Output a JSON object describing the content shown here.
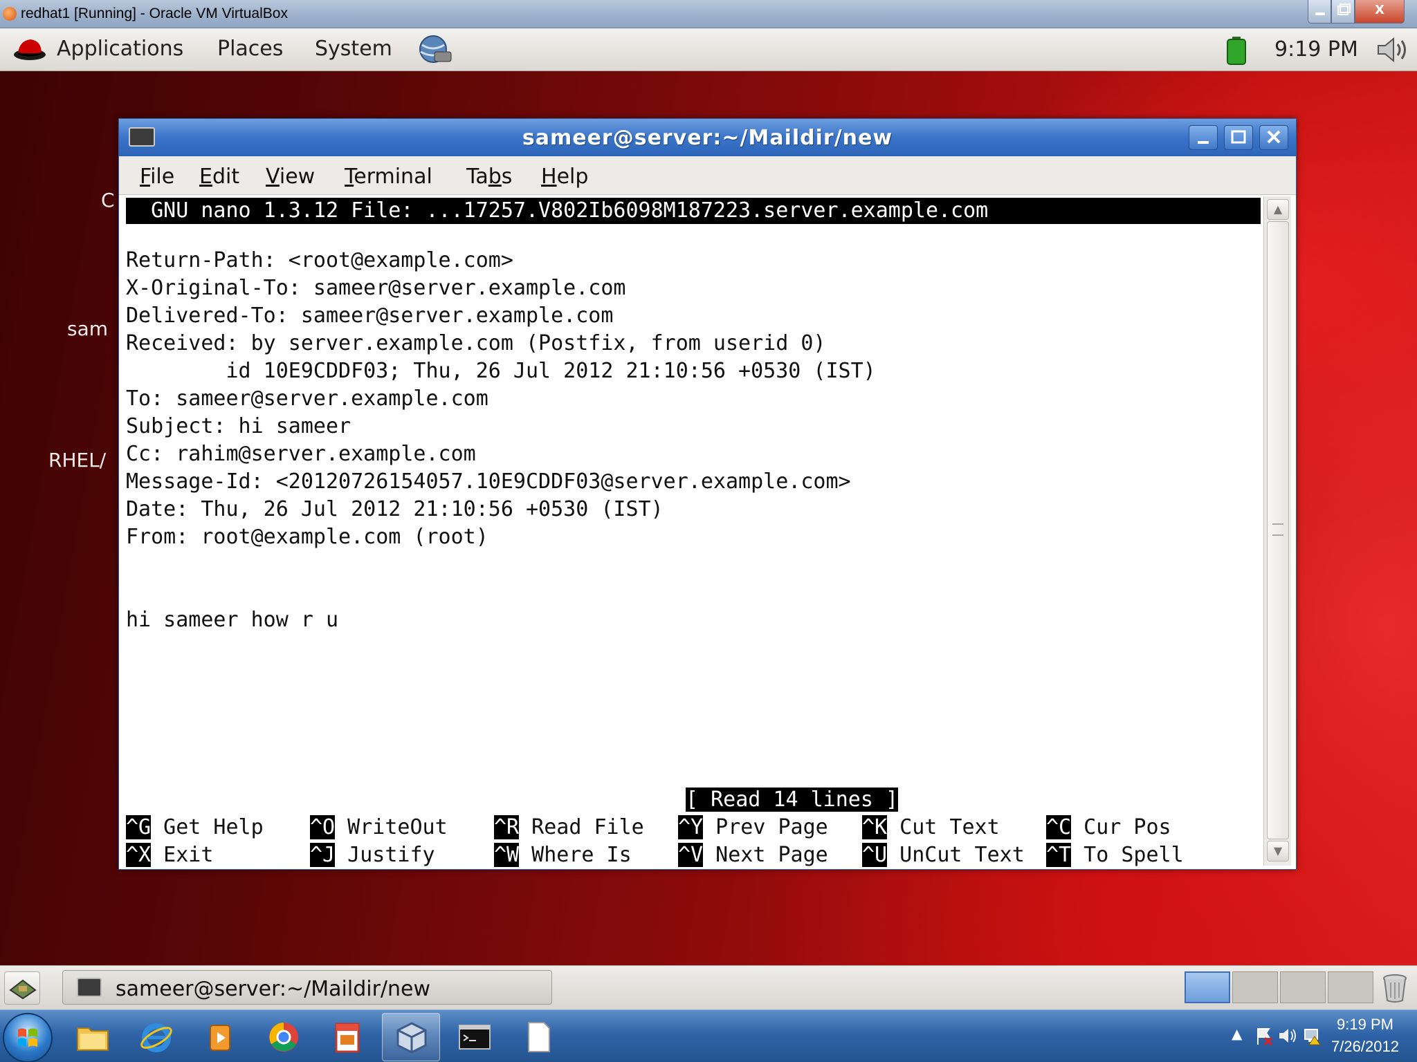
{
  "vbox": {
    "title": "redhat1 [Running] - Oracle VM VirtualBox",
    "close_label": "X"
  },
  "top_panel": {
    "menus": [
      "Applications",
      "Places",
      "System"
    ],
    "clock": "9:19 PM"
  },
  "desktop": {
    "icon_labels": [
      "C",
      "sam",
      "RHEL/"
    ]
  },
  "terminal": {
    "title": "sameer@server:~/Maildir/new",
    "menu": [
      {
        "pre": "",
        "key": "F",
        "post": "ile"
      },
      {
        "pre": "",
        "key": "E",
        "post": "dit"
      },
      {
        "pre": "",
        "key": "V",
        "post": "iew"
      },
      {
        "pre": "",
        "key": "T",
        "post": "erminal"
      },
      {
        "pre": "Ta",
        "key": "b",
        "post": "s"
      },
      {
        "pre": "",
        "key": "H",
        "post": "elp"
      }
    ],
    "nano_header": "  GNU nano 1.3.12 File: ...17257.V802Ib6098M187223.server.example.com",
    "lines": [
      "Return-Path: <root@example.com>",
      "X-Original-To: sameer@server.example.com",
      "Delivered-To: sameer@server.example.com",
      "Received: by server.example.com (Postfix, from userid 0)",
      "        id 10E9CDDF03; Thu, 26 Jul 2012 21:10:56 +0530 (IST)",
      "To: sameer@server.example.com",
      "Subject: hi sameer",
      "Cc: rahim@server.example.com",
      "Message-Id: <20120726154057.10E9CDDF03@server.example.com>",
      "Date: Thu, 26 Jul 2012 21:10:56 +0530 (IST)",
      "From: root@example.com (root)",
      "",
      "",
      "hi sameer how r u"
    ],
    "status": "[ Read 14 lines ]",
    "shortcuts_row1": [
      {
        "key": "^G",
        "label": " Get Help"
      },
      {
        "key": "^O",
        "label": " WriteOut"
      },
      {
        "key": "^R",
        "label": " Read File"
      },
      {
        "key": "^Y",
        "label": " Prev Page"
      },
      {
        "key": "^K",
        "label": " Cut Text"
      },
      {
        "key": "^C",
        "label": " Cur Pos"
      }
    ],
    "shortcuts_row2": [
      {
        "key": "^X",
        "label": " Exit"
      },
      {
        "key": "^J",
        "label": " Justify"
      },
      {
        "key": "^W",
        "label": " Where Is"
      },
      {
        "key": "^V",
        "label": " Next Page"
      },
      {
        "key": "^U",
        "label": " UnCut Text"
      },
      {
        "key": "^T",
        "label": " To Spell"
      }
    ]
  },
  "bottom_panel": {
    "window_button_label": "sameer@server:~/Maildir/new"
  },
  "win_taskbar": {
    "time": "9:19 PM",
    "date": "7/26/2012",
    "tray_arrow": "▲"
  }
}
